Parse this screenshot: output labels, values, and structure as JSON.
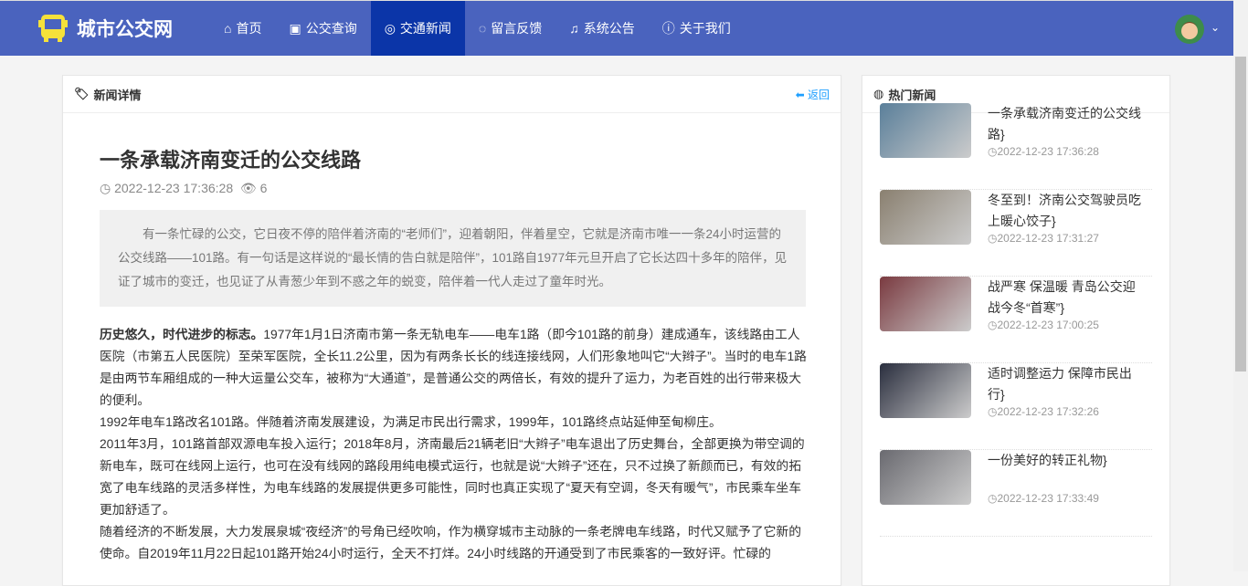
{
  "nav": {
    "brand": "城市公交网",
    "items": [
      {
        "label": "首页",
        "icon": "home-icon"
      },
      {
        "label": "公交查询",
        "icon": "bus-icon"
      },
      {
        "label": "交通新闻",
        "icon": "instagram-icon",
        "active": true
      },
      {
        "label": "留言反馈",
        "icon": "comment-icon"
      },
      {
        "label": "系统公告",
        "icon": "bell-icon"
      },
      {
        "label": "关于我们",
        "icon": "info-icon"
      }
    ]
  },
  "main": {
    "header": "新闻详情",
    "back": "返回",
    "title": "一条承载济南变迁的公交线路",
    "date": "2022-12-23 17:36:28",
    "views": "6",
    "summary": "有一条忙碌的公交，它日夜不停的陪伴着济南的“老师们”，迎着朝阳，伴着星空，它就是济南市唯一一条24小时运营的公交线路——101路。有一句话是这样说的“最长情的告白就是陪伴”，101路自1977年元旦开启了它长达四十多年的陪伴，见证了城市的变迁，也见证了从青葱少年到不惑之年的蜕变，陪伴着一代人走过了童年时光。",
    "p1_bold": "历史悠久，时代进步的标志。",
    "p1": "1977年1月1日济南市第一条无轨电车——电车1路（即今101路的前身）建成通车，该线路由工人医院（市第五人民医院）至荣军医院，全长11.2公里，因为有两条长长的线连接线网，人们形象地叫它“大辫子”。当时的电车1路是由两节车厢组成的一种大运量公交车，被称为“大通道”，是普通公交的两倍长，有效的提升了运力，为老百姓的出行带来极大的便利。",
    "p2": "1992年电车1路改名101路。伴随着济南发展建设，为满足市民出行需求，1999年，101路终点站延伸至甸柳庄。",
    "p3": "2011年3月，101路首部双源电车投入运行；2018年8月，济南最后21辆老旧“大辫子”电车退出了历史舞台，全部更换为带空调的新电车，既可在线网上运行，也可在没有线网的路段用纯电模式运行，也就是说“大辫子”还在，只不过换了新颜而已，有效的拓宽了电车线路的灵活多样性，为电车线路的发展提供更多可能性，同时也真正实现了“夏天有空调，冬天有暖气”，市民乘车坐车更加舒适了。",
    "p4": "随着经济的不断发展，大力发展泉城“夜经济”的号角已经吹响，作为横穿城市主动脉的一条老牌电车线路，时代又赋予了它新的使命。自2019年11月22日起101路开始24小时运行，全天不打烊。24小时线路的开通受到了市民乘客的一致好评。忙碌的"
  },
  "side": {
    "header": "热门新闻",
    "items": [
      {
        "title": "一条承载济南变迁的公交线路}",
        "date": "2022-12-23 17:36:28",
        "color": "#5a7f9a"
      },
      {
        "title": "冬至到！济南公交驾驶员吃上暖心饺子}",
        "date": "2022-12-23 17:31:27",
        "color": "#8a8070"
      },
      {
        "title": "战严寒 保温暖 青岛公交迎战今冬“首寒”}",
        "date": "2022-12-23 17:00:25",
        "color": "#7a3a40"
      },
      {
        "title": "适时调整运力 保障市民出行}",
        "date": "2022-12-23 17:32:26",
        "color": "#2a2e3e"
      },
      {
        "title": "一份美好的转正礼物}",
        "date": "2022-12-23 17:33:49",
        "color": "#6a6a70"
      }
    ]
  }
}
